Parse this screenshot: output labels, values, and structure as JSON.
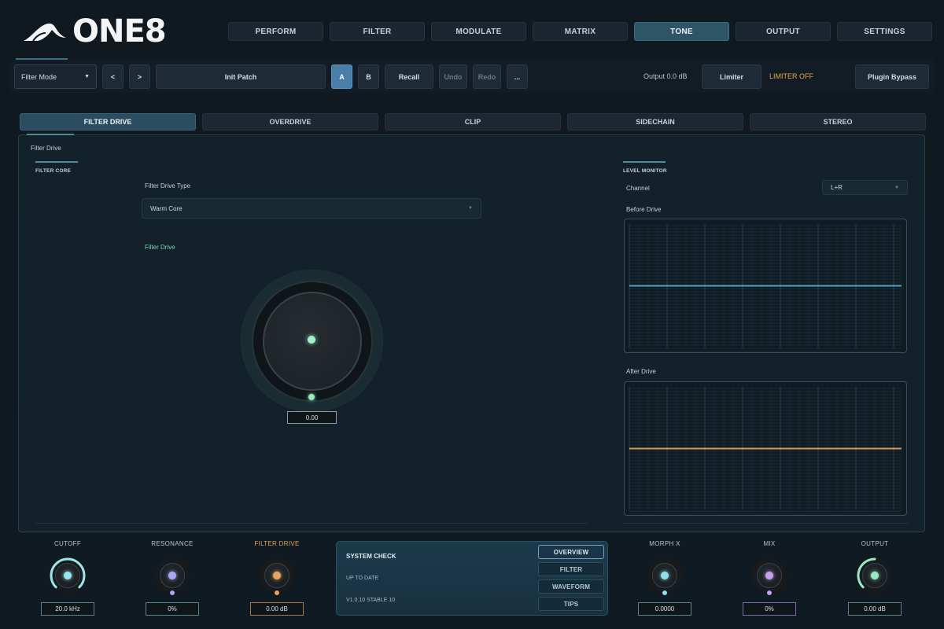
{
  "header": {
    "logo_text": "ONE8",
    "tabs": [
      {
        "label": "PERFORM",
        "active": false
      },
      {
        "label": "FILTER",
        "active": false
      },
      {
        "label": "MODULATE",
        "active": false
      },
      {
        "label": "MATRIX",
        "active": false
      },
      {
        "label": "TONE",
        "active": true
      },
      {
        "label": "OUTPUT",
        "active": false
      },
      {
        "label": "SETTINGS",
        "active": false
      }
    ]
  },
  "toolbar": {
    "filter_mode": "Filter Mode",
    "prev_label": "<",
    "next_label": ">",
    "patch_name": "Init Patch",
    "a_label": "A",
    "b_label": "B",
    "recall_label": "Recall",
    "undo_label": "Undo",
    "redo_label": "Redo",
    "more_label": "...",
    "output_level": "Output 0.0 dB",
    "limiter_label": "Limiter",
    "limiter_status": "LIMITER OFF",
    "bypass_label": "Plugin Bypass"
  },
  "sub_tabs": [
    {
      "label": "FILTER DRIVE",
      "active": true
    },
    {
      "label": "OVERDRIVE",
      "active": false
    },
    {
      "label": "CLIP",
      "active": false
    },
    {
      "label": "SIDECHAIN",
      "active": false
    },
    {
      "label": "STEREO",
      "active": false
    }
  ],
  "panel": {
    "title": "Filter Drive",
    "core_section": "FILTER CORE",
    "drive_type_label": "Filter Drive Type",
    "drive_type_value": "Warm Core",
    "drive_label": "Filter Drive",
    "drive_value": "0.00",
    "drive_level": 0.0,
    "monitor_section": "LEVEL MONITOR",
    "channel_label": "Channel",
    "channel_value": "L+R",
    "before_label": "Before Drive",
    "after_label": "After Drive",
    "before_line_color": "#4fa3c4",
    "after_line_color": "#d49b5a"
  },
  "bottom": {
    "knobs": [
      {
        "label": "CUTOFF",
        "value": "20.0 kHz",
        "dot_color": "#9be6ea",
        "level": 1.0
      },
      {
        "label": "RESONANCE",
        "value": "0%",
        "dot_color": "#a7a8f0",
        "level": 0.0
      },
      {
        "label": "FILTER DRIVE",
        "value": "0.00 dB",
        "dot_color": "#e8a562",
        "level": 0.0
      },
      {
        "label": "MORPH X",
        "value": "0.0000",
        "dot_color": "#8fe0ea",
        "level": 0.0
      },
      {
        "label": "MIX",
        "value": "0%",
        "dot_color": "#c79ff0",
        "level": 0.0
      },
      {
        "label": "OUTPUT",
        "value": "0.00 dB",
        "dot_color": "#9be8c8",
        "level": 0.5
      }
    ],
    "system_check": {
      "title": "SYSTEM CHECK",
      "status": "UP TO DATE",
      "version": "V1.0.10 STABLE 10",
      "buttons": [
        {
          "label": "OVERVIEW",
          "active": true
        },
        {
          "label": "FILTER",
          "active": false
        },
        {
          "label": "WAVEFORM",
          "active": false
        },
        {
          "label": "TIPS",
          "active": false
        }
      ]
    }
  },
  "accent_color": "#2e5566"
}
